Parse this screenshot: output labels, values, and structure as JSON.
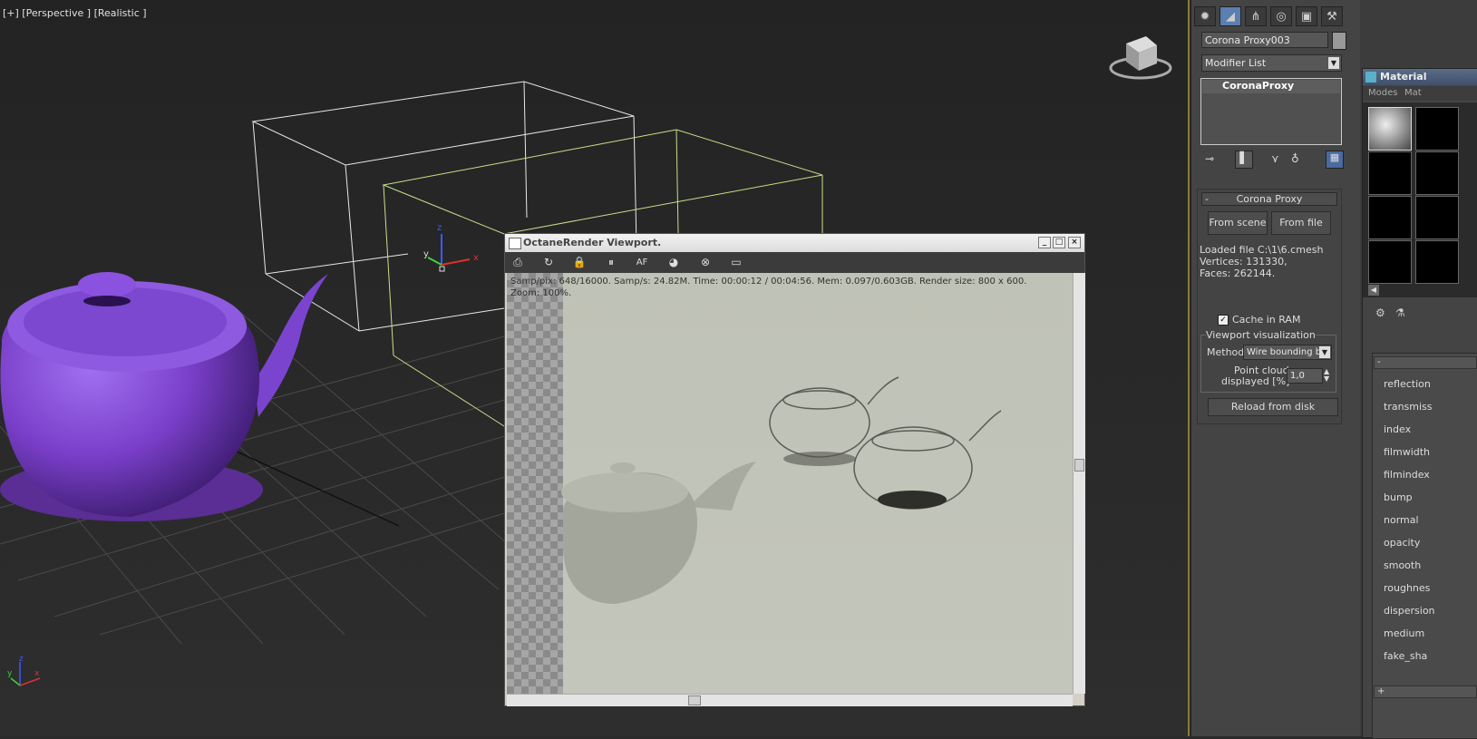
{
  "viewport": {
    "label": "[+] [Perspective ] [Realistic ]",
    "axis_labels": {
      "x": "x",
      "y": "y",
      "z": "z"
    }
  },
  "command_panel": {
    "tab_icons": [
      "create-icon",
      "modify-icon",
      "hierarchy-icon",
      "motion-icon",
      "display-icon",
      "utilities-icon"
    ],
    "object_name": "Corona Proxy003",
    "modifier_list": "Modifier List",
    "stack_item": "CoronaProxy",
    "rollout_title": "Corona Proxy",
    "rollout_toggle": "-",
    "from_scene": "From scene",
    "from_file": "From file",
    "loaded_file": "Loaded file C:\\1\\6.cmesh",
    "vertices": "Vertices: 131330,",
    "faces": "Faces: 262144.",
    "cache_label": "Cache in RAM",
    "cache_checked": true,
    "group_title": "Viewport visualization",
    "method_label": "Method",
    "method_value": "Wire bounding bo",
    "point_cloud_label_1": "Point cloud",
    "point_cloud_label_2": "displayed [%]",
    "point_cloud_value": "1,0",
    "reload": "Reload from disk"
  },
  "material_editor": {
    "title": "Material",
    "menu": [
      "Modes",
      "Mat"
    ],
    "rollout_toggle": "-",
    "params": [
      "reflection",
      "transmiss",
      "index",
      "filmwidth",
      "filmindex",
      "bump",
      "normal",
      "opacity",
      "smooth",
      "roughnes",
      "dispersion",
      "medium",
      "fake_sha"
    ],
    "bottom_toggle": "+"
  },
  "octane": {
    "title": "OctaneRender Viewport.",
    "toolbar_icons": [
      "save-icon",
      "refresh-icon",
      "lock-icon",
      "pause-icon",
      "autofocus-icon",
      "color-icon",
      "target-icon",
      "display-icon"
    ],
    "toolbar_glyphs": [
      "⎙",
      "↻",
      "🔒",
      "⏸",
      "AF",
      "◕",
      "⊗",
      "▭"
    ],
    "stats_line": "Samp/pix: 648/16000.   Samp/s: 24.82M.   Time: 00:00:12 / 00:04:56.   Mem: 0.097/0.603GB.   Render size: 800 x 600.",
    "zoom": "Zoom: 100%.",
    "win_min": "_",
    "win_max": "□",
    "win_close": "×"
  },
  "colors": {
    "viewport_bg": "#2b2b2b",
    "teapot_purple": "#7a3fc9",
    "wire_white": "#e8e8e8",
    "wire_green": "#c8e08a",
    "panel_bg": "#444444",
    "render_bg": "#b9bcb0"
  }
}
